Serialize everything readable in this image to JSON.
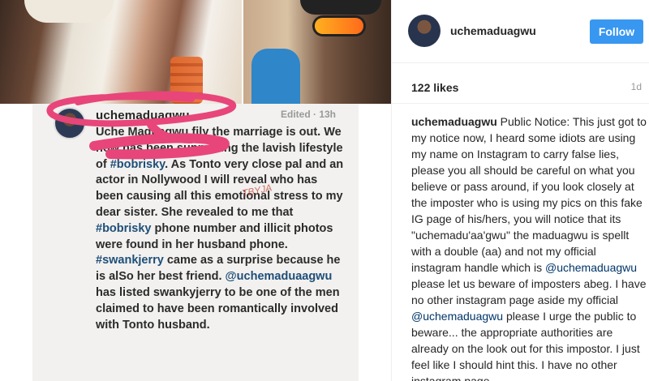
{
  "post_image": {
    "username": "uchemaduagwu",
    "edited": "Edited · 13h",
    "stamp": "TBYJA",
    "body_parts": [
      {
        "t": "Uche Maduagwu fi",
        "tag": false
      },
      {
        "t": "ly the marriage",
        "tag": false
      },
      {
        "t": " is out. We now",
        "tag": false
      },
      {
        "t": " has been supporting the lavish lifestyle of ",
        "tag": false
      },
      {
        "t": "#bobrisky",
        "tag": true
      },
      {
        "t": ". As Tonto very close pal and an actor in Nollywood I will reveal who has been causing all this emotional stress to my dear sister. She revealed to me that ",
        "tag": false
      },
      {
        "t": "#bobrisky",
        "tag": true
      },
      {
        "t": " phone number and illicit photos were found in her husband phone. ",
        "tag": false
      },
      {
        "t": "#swankjerry",
        "tag": true
      },
      {
        "t": " came as a surprise because he is alSo her best friend. ",
        "tag": false
      },
      {
        "t": "@uchemaduaagwu",
        "tag": true
      },
      {
        "t": " has listed swankyjerry to be one of the men claimed to have been romantically involved with Tonto husband.",
        "tag": false
      }
    ]
  },
  "sidebar": {
    "username": "uchemaduagwu",
    "follow_label": "Follow",
    "likes": "122 likes",
    "age": "1d"
  },
  "caption": {
    "username": "uchemaduagwu",
    "text1": " Public Notice: This just got to my notice now, I heard some idiots are using my name on Instagram to carry false lies, please you all should be careful on what you believe or pass around, if you look closely at the imposter who is using my pics on this fake IG page of his/hers, you will notice that its \"uchemadu'aa'gwu\" the maduagwu is spellt with a double (aa) and not my official instagram handle which is ",
    "mention1": "@uchemaduagwu",
    "text2": " please let us beware of imposters abeg. I have no other instagram page aside my official ",
    "mention2": "@uchemaduagwu",
    "text3": " please I urge the public to beware... the appropriate authorities are already on the look out for this impostor. I just feel like I should hint this. I have no other instagram page"
  },
  "colors": {
    "follow": "#3897f0",
    "hashtag": "#1e4e78",
    "scribble": "#e8457a"
  },
  "icons": {
    "avatar": "profile-photo"
  }
}
